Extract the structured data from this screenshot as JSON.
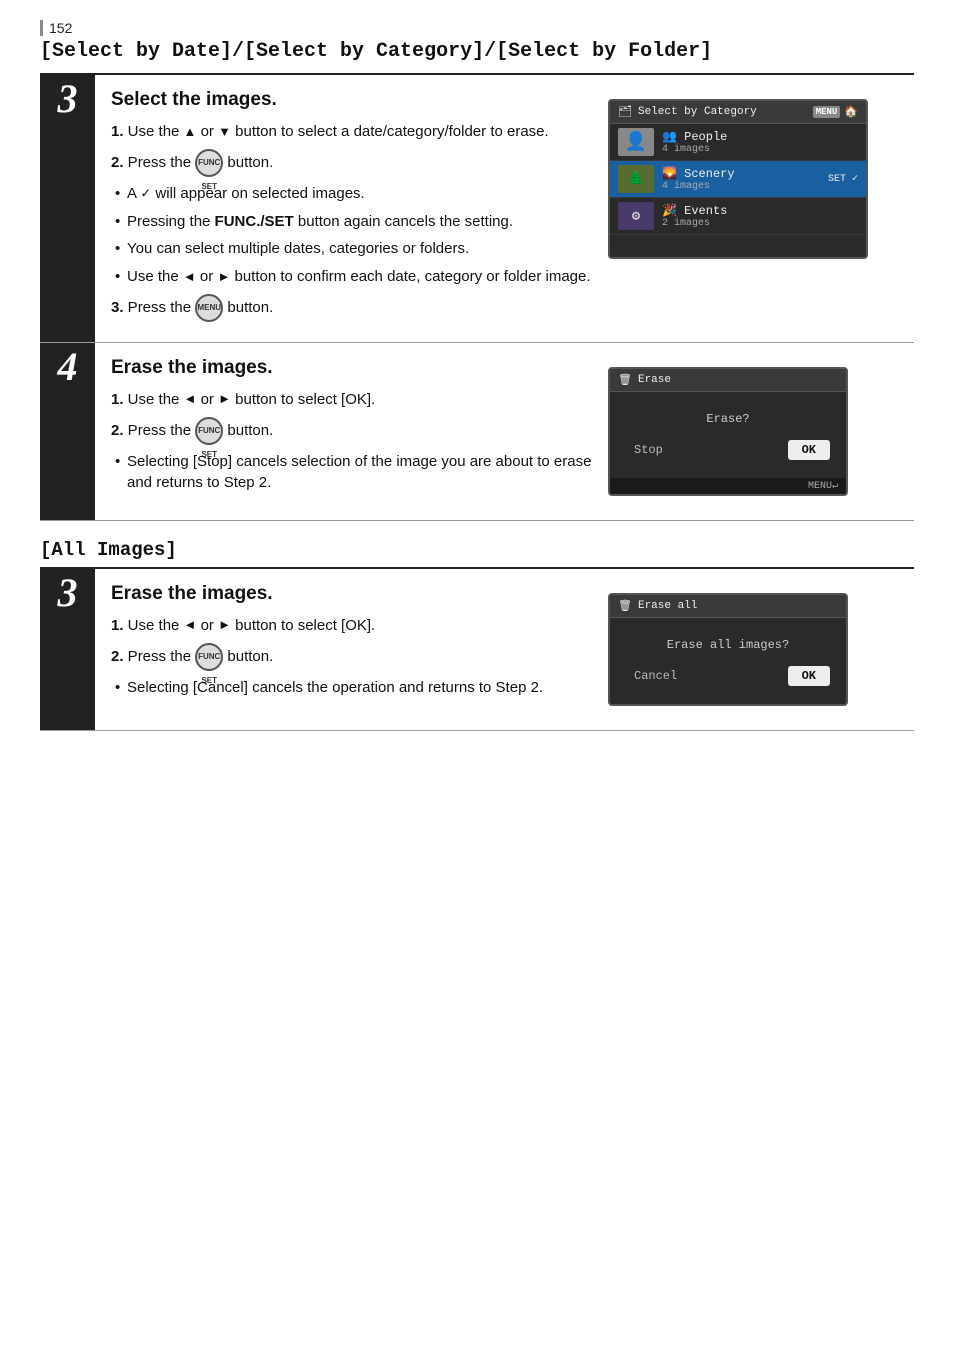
{
  "page": {
    "number": "152",
    "section_title": "[Select by Date]/[Select by Category]/[Select by Folder]",
    "subsection_title": "[All Images]",
    "steps": [
      {
        "num": "3",
        "title": "Select the images.",
        "instructions": [
          {
            "type": "numbered",
            "num": "1.",
            "text": "Use the ▲ or ▼ button to select a date/category/folder to erase."
          },
          {
            "type": "numbered",
            "num": "2.",
            "text": "Press the FUNC button."
          },
          {
            "type": "bullet",
            "text": "A ✓ will appear on selected images."
          },
          {
            "type": "bullet",
            "text": "Pressing the FUNC./SET button again cancels the setting."
          },
          {
            "type": "bullet",
            "text": "You can select multiple dates, categories or folders."
          },
          {
            "type": "bullet",
            "text": "Use the ◄ or ► button to confirm each date, category or folder image."
          },
          {
            "type": "numbered",
            "num": "3.",
            "text": "Press the MENU button."
          }
        ],
        "screen": {
          "type": "category",
          "header_icon": "🗂",
          "header_title": "Select by Category",
          "menu_label": "MENU",
          "home_label": "🏠",
          "rows": [
            {
              "icon_type": "people",
              "icon_label": "👤",
              "category": "People",
              "count": "4 images",
              "selected": false,
              "highlighted": false,
              "badge": ""
            },
            {
              "icon_type": "scenery",
              "icon_label": "🌲",
              "category": "Scenery",
              "count": "4 images",
              "selected": true,
              "highlighted": true,
              "badge": "SET ✓"
            },
            {
              "icon_type": "events",
              "icon_label": "⚙",
              "category": "Events",
              "count": "2 images",
              "selected": false,
              "highlighted": false,
              "badge": ""
            }
          ]
        }
      },
      {
        "num": "4",
        "title": "Erase the images.",
        "instructions": [
          {
            "type": "numbered",
            "num": "1.",
            "text": "Use the ◄ or ► button to select [OK]."
          },
          {
            "type": "numbered",
            "num": "2.",
            "text": "Press the FUNC button."
          },
          {
            "type": "bullet",
            "text": "Selecting [Stop] cancels selection of the image you are about to erase and returns to Step 2."
          }
        ],
        "screen": {
          "type": "erase",
          "header_icon": "🗑",
          "header_title": "Erase",
          "question": "Erase?",
          "btn_stop": "Stop",
          "btn_ok": "OK",
          "footer": "MENU↵"
        }
      }
    ],
    "all_images_steps": [
      {
        "num": "3",
        "title": "Erase the images.",
        "instructions": [
          {
            "type": "numbered",
            "num": "1.",
            "text": "Use the ◄ or ► button to select [OK]."
          },
          {
            "type": "numbered",
            "num": "2.",
            "text": "Press the FUNC button."
          },
          {
            "type": "bullet",
            "text": "Selecting [Cancel] cancels the operation and returns to Step 2."
          }
        ],
        "screen": {
          "type": "erase_all",
          "header_icon": "🗑",
          "header_title": "Erase all",
          "question": "Erase all images?",
          "btn_cancel": "Cancel",
          "btn_ok": "OK"
        }
      }
    ]
  }
}
